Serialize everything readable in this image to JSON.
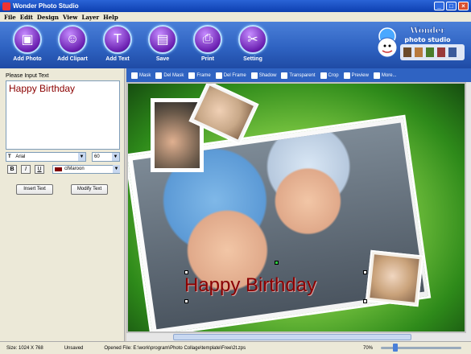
{
  "window": {
    "title": "Wonder Photo Studio",
    "btn_min": "_",
    "btn_max": "□",
    "btn_close": "×"
  },
  "menu": [
    "File",
    "Edit",
    "Design",
    "View",
    "Layer",
    "Help"
  ],
  "toolbar": {
    "buttons": [
      {
        "label": "Add Photo",
        "icon": "add-photo-icon"
      },
      {
        "label": "Add Clipart",
        "icon": "add-clipart-icon"
      },
      {
        "label": "Add Text",
        "icon": "add-text-icon"
      },
      {
        "label": "Save",
        "icon": "save-icon"
      },
      {
        "label": "Print",
        "icon": "print-icon"
      },
      {
        "label": "Setting",
        "icon": "setting-icon"
      }
    ],
    "logo_line1": "Wonder",
    "logo_line2": "photo studio"
  },
  "textpanel": {
    "prompt": "Please Input Text",
    "text_value": "Happy Birthday",
    "font_name": "Arial",
    "font_size": "60",
    "bold": "B",
    "italic": "I",
    "underline": "U",
    "color_name": "clMaroon",
    "color_hex": "#800000",
    "insert_button": "Insert Text",
    "modify_button": "Modify Text"
  },
  "image_toolbar": [
    "Mask",
    "Del Mask",
    "Frame",
    "Del Frame",
    "Shadow",
    "Transparent",
    "Crop",
    "Preview",
    "More..."
  ],
  "canvas": {
    "caption": "Happy Birthday"
  },
  "status": {
    "size": "Size: 1024 X 768",
    "saved": "Unsaved",
    "opened": "Opened File:  E:\\work\\program\\Photo Collage\\template\\Free\\2t.zps",
    "zoom": "70%"
  }
}
